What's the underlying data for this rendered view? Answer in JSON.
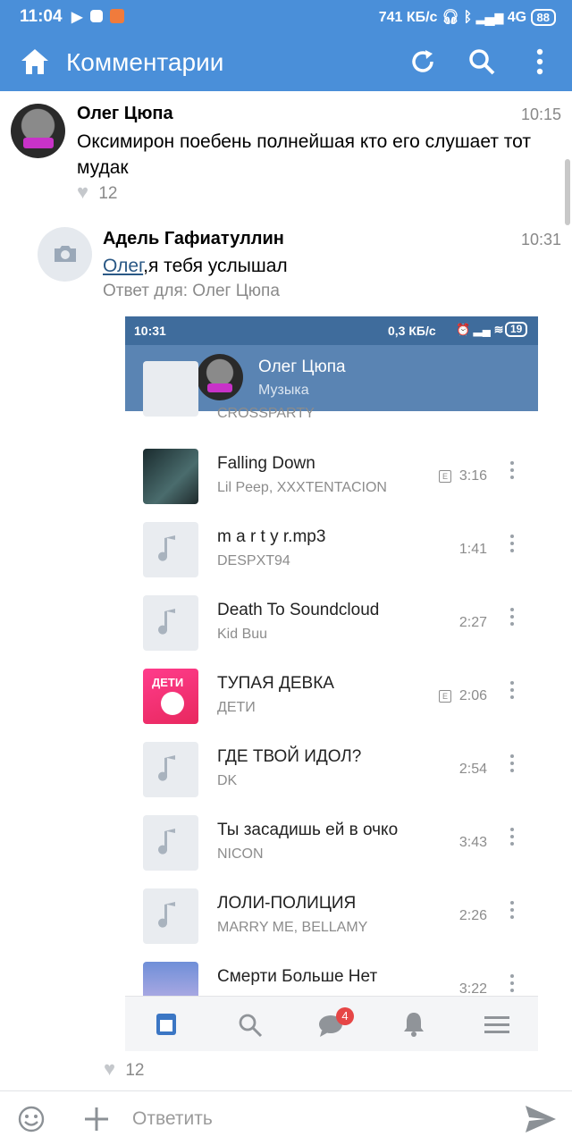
{
  "status_bar": {
    "time": "11:04",
    "speed": "741 КБ/с",
    "network": "4G",
    "battery": "88"
  },
  "app_bar": {
    "title": "Комментарии",
    "icons": [
      "home-icon",
      "refresh-icon",
      "search-icon",
      "more-vert-icon"
    ]
  },
  "comments": [
    {
      "author": "Олег Цюпа",
      "time": "10:15",
      "text": "Оксимирон поебень полнейшая кто его слушает тот мудак",
      "likes": "12"
    },
    {
      "author": "Адель Гафиатуллин",
      "time": "10:31",
      "mention": "Олег",
      "text": ",я тебя услышал",
      "reply_to": "Ответ для: Олег Цюпа",
      "likes": "12"
    }
  ],
  "attachment": {
    "status_bar": {
      "time": "10:31",
      "speed": "0,3 КБ/с",
      "battery": "19"
    },
    "header": {
      "name": "Олег Цюпа",
      "subtitle": "Музыка"
    },
    "cut_track_artist": "CROSSPARTY",
    "tracks": [
      {
        "title": "Falling Down",
        "artist": "Lil Peep, XXXTENTACION",
        "duration": "3:16",
        "explicit": true,
        "cover": "photo"
      },
      {
        "title": "m a r t y r.mp3",
        "artist": "DESPXT94",
        "duration": "1:41",
        "explicit": false,
        "cover": "note"
      },
      {
        "title": "Death To Soundcloud",
        "artist": "Kid Buu",
        "duration": "2:27",
        "explicit": false,
        "cover": "note"
      },
      {
        "title": "ТУПАЯ ДЕВКА",
        "artist": "ДЕТИ",
        "duration": "2:06",
        "explicit": true,
        "cover": "pink"
      },
      {
        "title": "ГДЕ ТВОЙ ИДОЛ?",
        "artist": "DK",
        "duration": "2:54",
        "explicit": false,
        "cover": "note"
      },
      {
        "title": "Ты засадишь ей в очко",
        "artist": "NICON",
        "duration": "3:43",
        "explicit": false,
        "cover": "note"
      },
      {
        "title": "ЛОЛИ-ПОЛИЦИЯ",
        "artist": "MARRY ME, BELLAMY",
        "duration": "2:26",
        "explicit": false,
        "cover": "note"
      },
      {
        "title": "Смерти Больше Нет",
        "artist": "",
        "duration": "3:22",
        "explicit": false,
        "cover": "photo2"
      }
    ],
    "cover_pink_text": "ДЕТИ",
    "nav_badge": "4"
  },
  "input": {
    "placeholder": "Ответить"
  },
  "colors": {
    "accent": "#4a8fd9",
    "embedded_header": "#5a84b3",
    "link": "#2a5885",
    "badge": "#e64646"
  }
}
